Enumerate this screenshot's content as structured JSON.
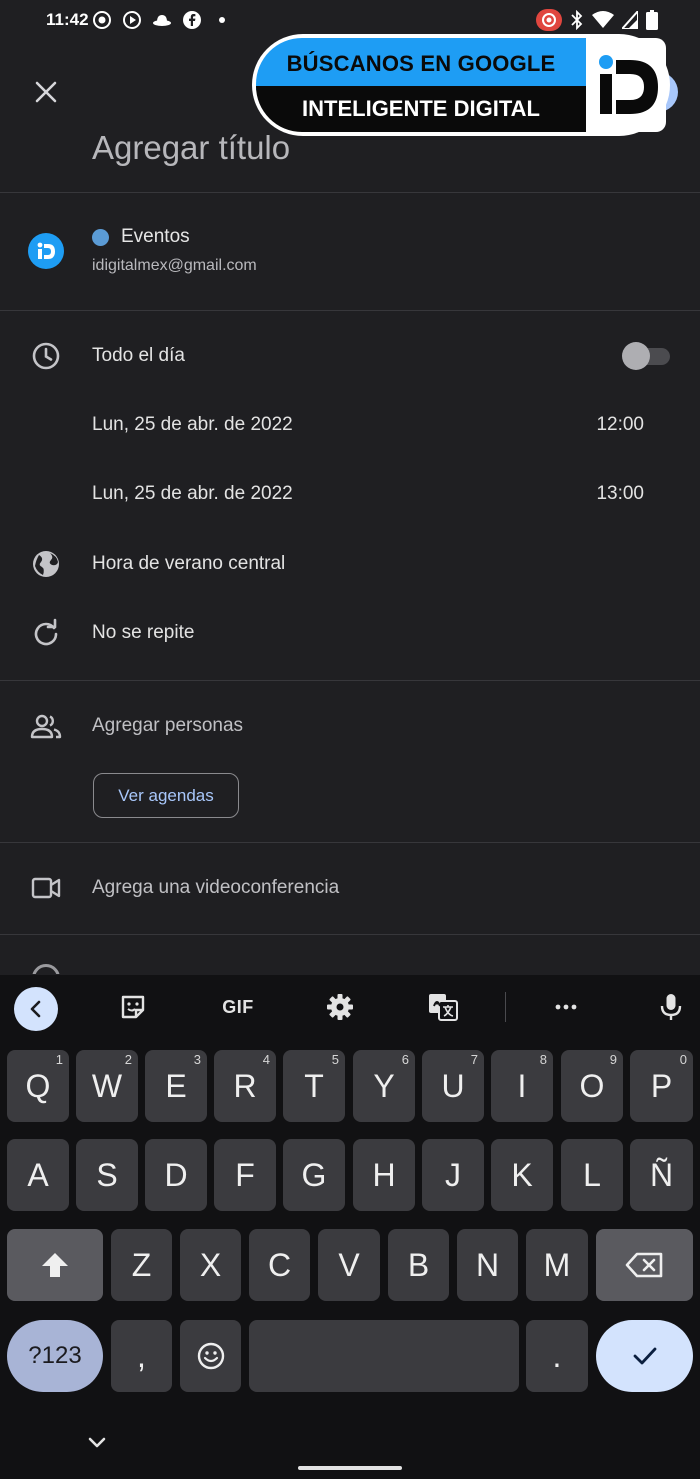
{
  "status_bar": {
    "time": "11:42"
  },
  "ad_banner": {
    "line1": "BÚSCANOS EN GOOGLE",
    "line2": "INTELIGENTE DIGITAL"
  },
  "header": {
    "title_placeholder": "Agregar título"
  },
  "calendar": {
    "name": "Eventos",
    "email": "idigitalmex@gmail.com",
    "color": "#5b9bd5"
  },
  "schedule": {
    "all_day_label": "Todo el día",
    "all_day_enabled": false,
    "start": {
      "date": "Lun, 25 de abr. de 2022",
      "time": "12:00"
    },
    "end": {
      "date": "Lun, 25 de abr. de 2022",
      "time": "13:00"
    },
    "timezone": "Hora de verano central",
    "repeat": "No se repite"
  },
  "people": {
    "add_label": "Agregar personas",
    "agendas_button": "Ver agendas"
  },
  "video": {
    "label": "Agrega una videoconferencia"
  },
  "keyboard": {
    "toolbar": {
      "gif_label": "GIF"
    },
    "row1": [
      {
        "label": "Q",
        "hint": "1"
      },
      {
        "label": "W",
        "hint": "2"
      },
      {
        "label": "E",
        "hint": "3"
      },
      {
        "label": "R",
        "hint": "4"
      },
      {
        "label": "T",
        "hint": "5"
      },
      {
        "label": "Y",
        "hint": "6"
      },
      {
        "label": "U",
        "hint": "7"
      },
      {
        "label": "I",
        "hint": "8"
      },
      {
        "label": "O",
        "hint": "9"
      },
      {
        "label": "P",
        "hint": "0"
      }
    ],
    "row2": [
      "A",
      "S",
      "D",
      "F",
      "G",
      "H",
      "J",
      "K",
      "L",
      "Ñ"
    ],
    "row3": [
      "Z",
      "X",
      "C",
      "V",
      "B",
      "N",
      "M"
    ],
    "symbols_label": "?123",
    "comma_label": ",",
    "period_label": "."
  },
  "colors": {
    "accent": "#a8c7fa",
    "background": "#1f1f22",
    "keyboard_bg": "#111113",
    "key_bg": "#3b3b3f"
  }
}
